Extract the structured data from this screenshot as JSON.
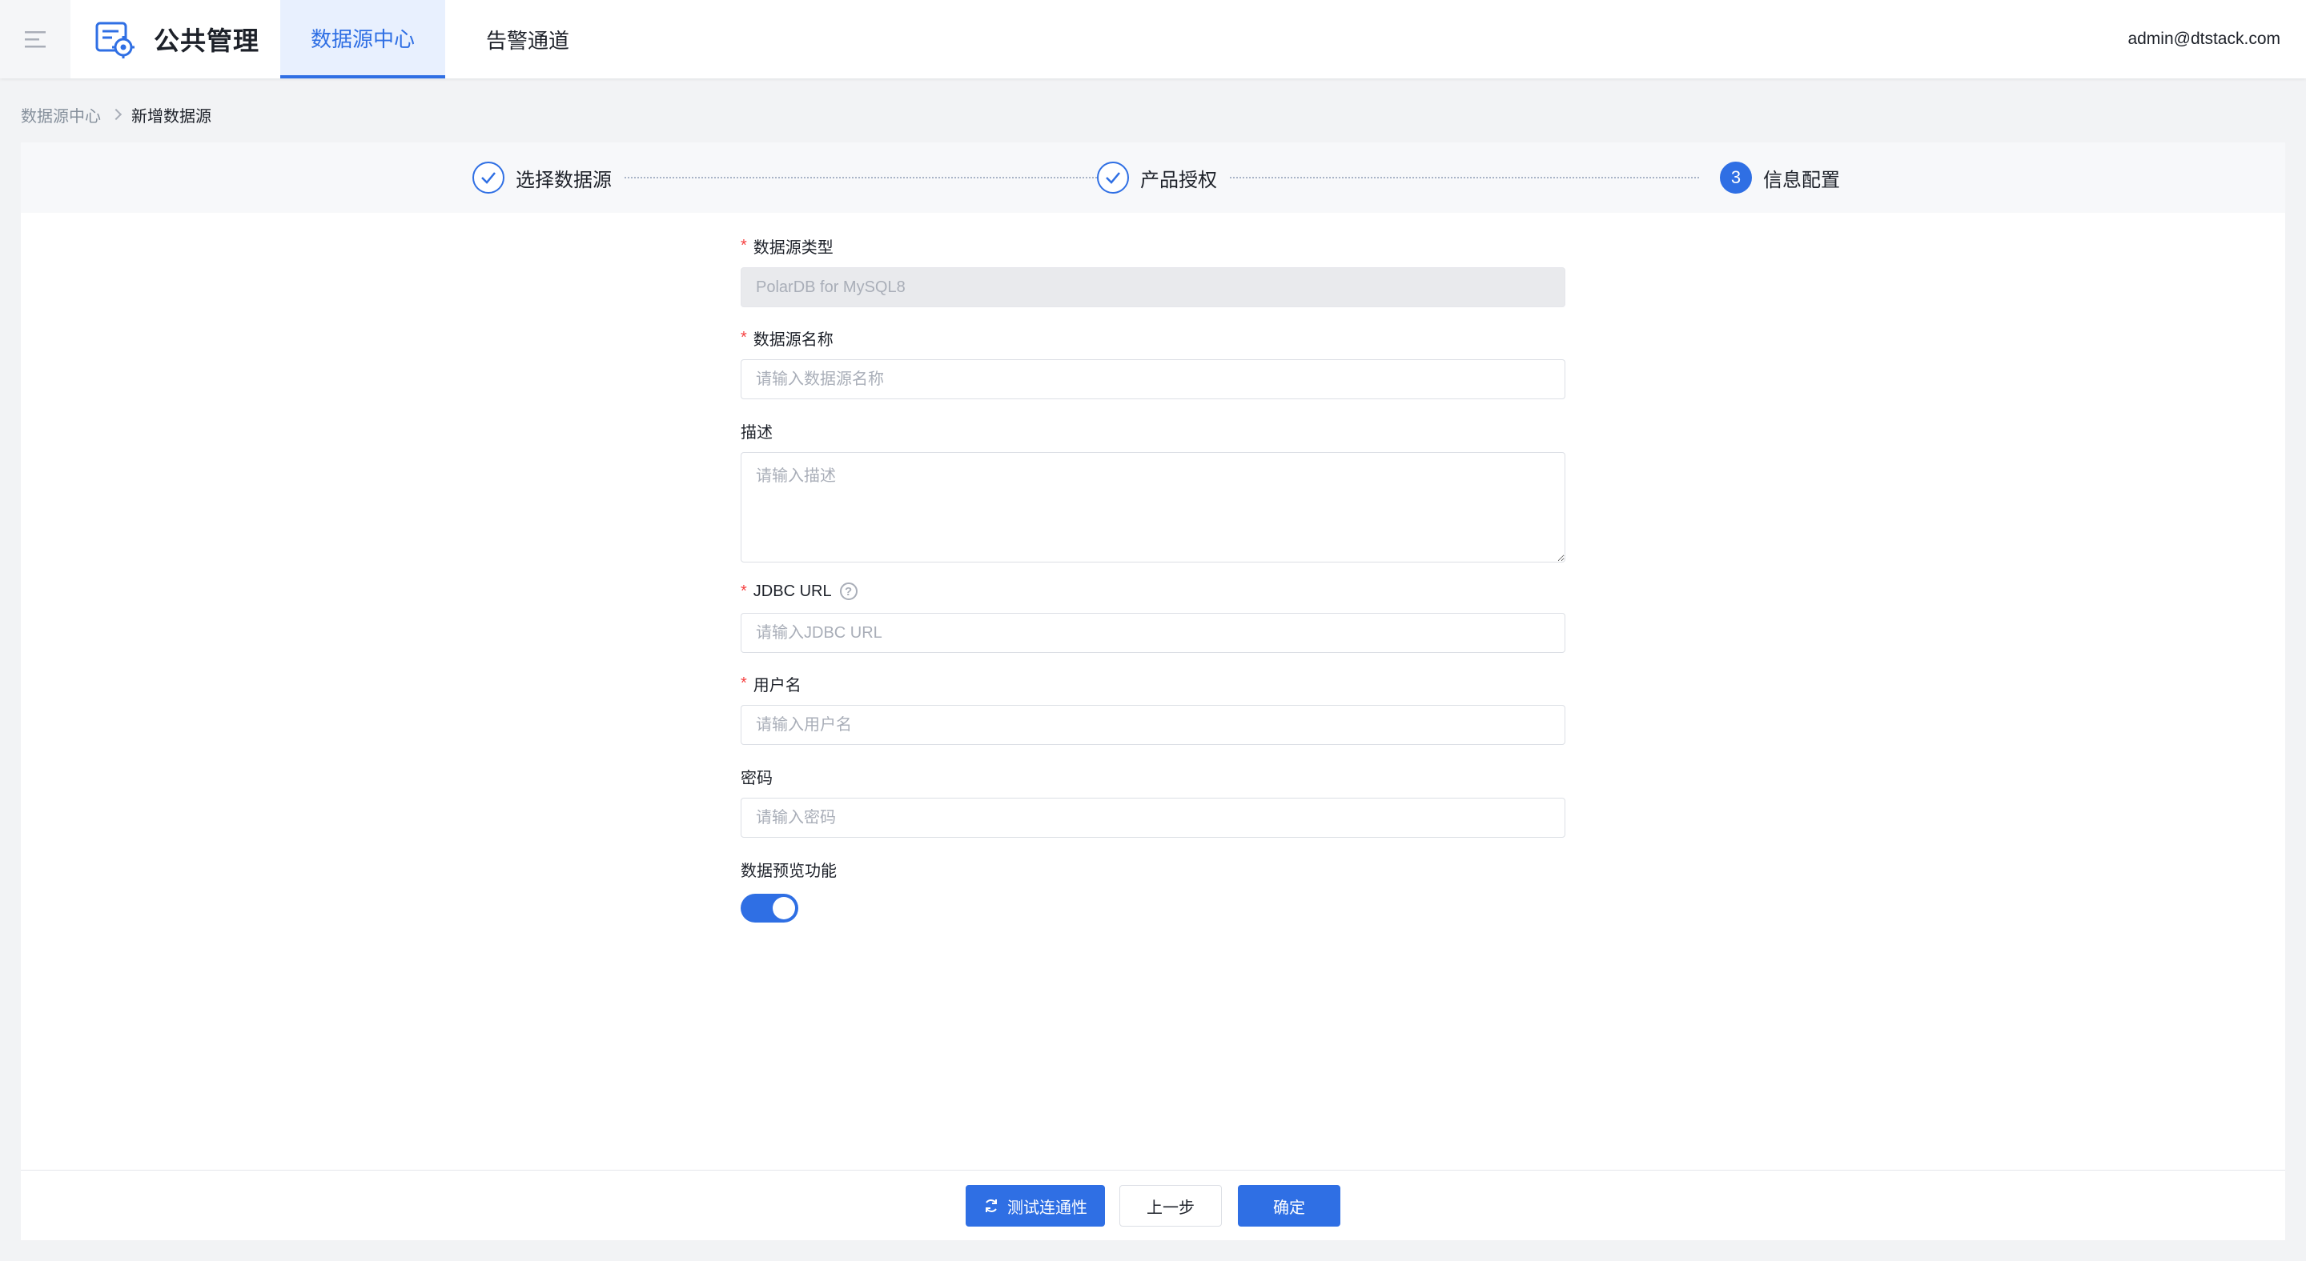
{
  "header": {
    "brand_title": "公共管理",
    "tabs": [
      {
        "label": "数据源中心",
        "active": true
      },
      {
        "label": "告警通道",
        "active": false
      }
    ],
    "user": "admin@dtstack.com"
  },
  "breadcrumb": {
    "parent": "数据源中心",
    "current": "新增数据源"
  },
  "steps": [
    {
      "label": "选择数据源",
      "status": "done"
    },
    {
      "label": "产品授权",
      "status": "done"
    },
    {
      "label": "信息配置",
      "status": "current",
      "number": "3"
    }
  ],
  "form": {
    "type": {
      "label": "数据源类型",
      "value": "PolarDB for MySQL8",
      "required": "*"
    },
    "name": {
      "label": "数据源名称",
      "placeholder": "请输入数据源名称",
      "required": "*"
    },
    "description": {
      "label": "描述",
      "placeholder": "请输入描述"
    },
    "jdbc_url": {
      "label": "JDBC URL",
      "placeholder": "请输入JDBC URL",
      "required": "*",
      "help": "?"
    },
    "username": {
      "label": "用户名",
      "placeholder": "请输入用户名",
      "required": "*"
    },
    "password": {
      "label": "密码",
      "placeholder": "请输入密码"
    },
    "preview": {
      "label": "数据预览功能",
      "enabled": true
    }
  },
  "footer": {
    "test_label": "测试连通性",
    "prev_label": "上一步",
    "confirm_label": "确定"
  },
  "colors": {
    "primary": "#2f6fe4",
    "required": "#f53f3f"
  }
}
